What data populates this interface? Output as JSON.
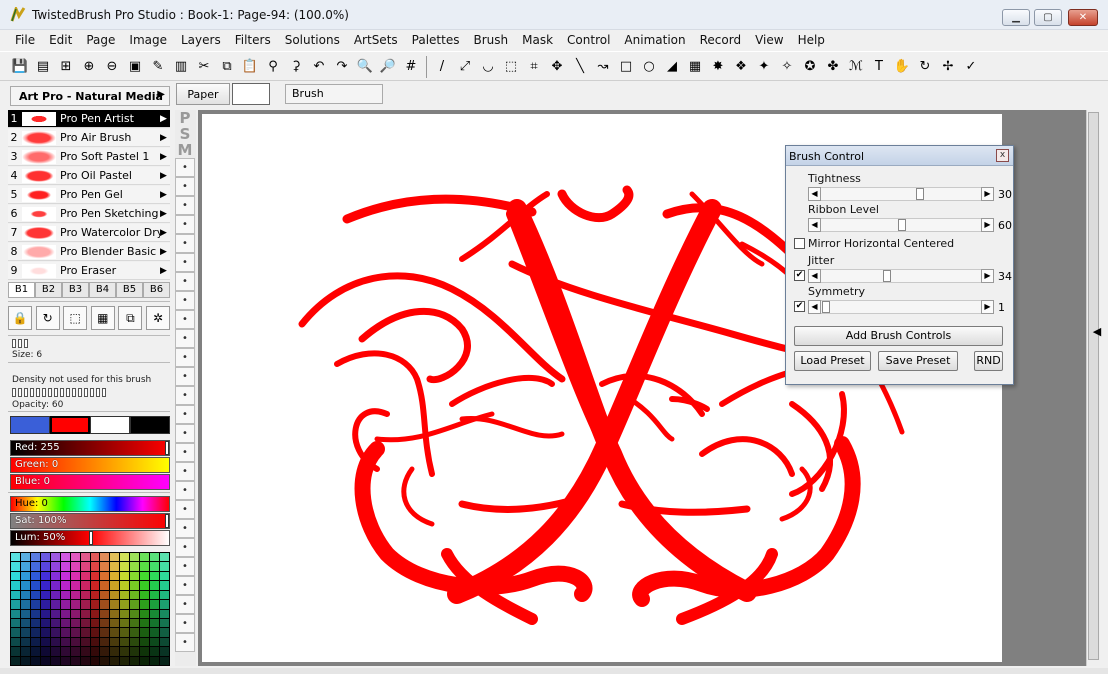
{
  "window": {
    "title": "TwistedBrush Pro Studio : Book-1: Page-94:  (100.0%)",
    "minimize_label": "▁",
    "maximize_label": "▢",
    "close_label": "✕"
  },
  "menu": [
    "File",
    "Edit",
    "Page",
    "Image",
    "Layers",
    "Filters",
    "Solutions",
    "ArtSets",
    "Palettes",
    "Brush",
    "Mask",
    "Control",
    "Animation",
    "Record",
    "View",
    "Help"
  ],
  "subbar": {
    "artset_name": "Art Pro - Natural Media",
    "paper_label": "Paper",
    "brush_label": "Brush"
  },
  "brushes": [
    {
      "num": "1",
      "name": "Pro Pen Artist"
    },
    {
      "num": "2",
      "name": "Pro Air Brush"
    },
    {
      "num": "3",
      "name": "Pro Soft Pastel 1"
    },
    {
      "num": "4",
      "name": "Pro Oil Pastel"
    },
    {
      "num": "5",
      "name": "Pro Pen Gel"
    },
    {
      "num": "6",
      "name": "Pro Pen Sketching"
    },
    {
      "num": "7",
      "name": "Pro Watercolor Dry 2"
    },
    {
      "num": "8",
      "name": "Pro Blender Basic"
    },
    {
      "num": "9",
      "name": "Pro Eraser"
    }
  ],
  "brush_tabs": [
    "B1",
    "B2",
    "B3",
    "B4",
    "B5",
    "B6"
  ],
  "brush_settings": {
    "size_label": "Size: 6",
    "density_label": "Density not used for this brush",
    "opacity_label": "Opacity: 60"
  },
  "color_sliders": {
    "red": "Red: 255",
    "green": "Green: 0",
    "blue": "Blue: 0",
    "hue": "Hue: 0",
    "sat": "Sat: 100%",
    "lum": "Lum: 50%"
  },
  "colors": {
    "primary": "#ff0000",
    "secondary": "#ffffff",
    "blue_swatch": "#3a5fd8",
    "black_swatch": "#000000",
    "stroke": "#ff0000"
  },
  "psm": [
    "P",
    "S",
    "M"
  ],
  "brush_control": {
    "title": "Brush Control",
    "close_label": "x",
    "tightness_label": "Tightness",
    "tightness_value": "30",
    "tightness_level": 0.62,
    "ribbon_label": "Ribbon Level",
    "ribbon_value": "60",
    "ribbon_level": 0.5,
    "mirror_label": "Mirror Horizontal Centered",
    "mirror_checked": false,
    "jitter_label": "Jitter",
    "jitter_value": "34",
    "jitter_checked": true,
    "jitter_level": 0.4,
    "symmetry_label": "Symmetry",
    "symmetry_value": "1",
    "symmetry_checked": true,
    "symmetry_level": 0.0,
    "add_controls_label": "Add Brush Controls",
    "load_preset_label": "Load Preset",
    "save_preset_label": "Save Preset",
    "rnd_label": "RND"
  }
}
